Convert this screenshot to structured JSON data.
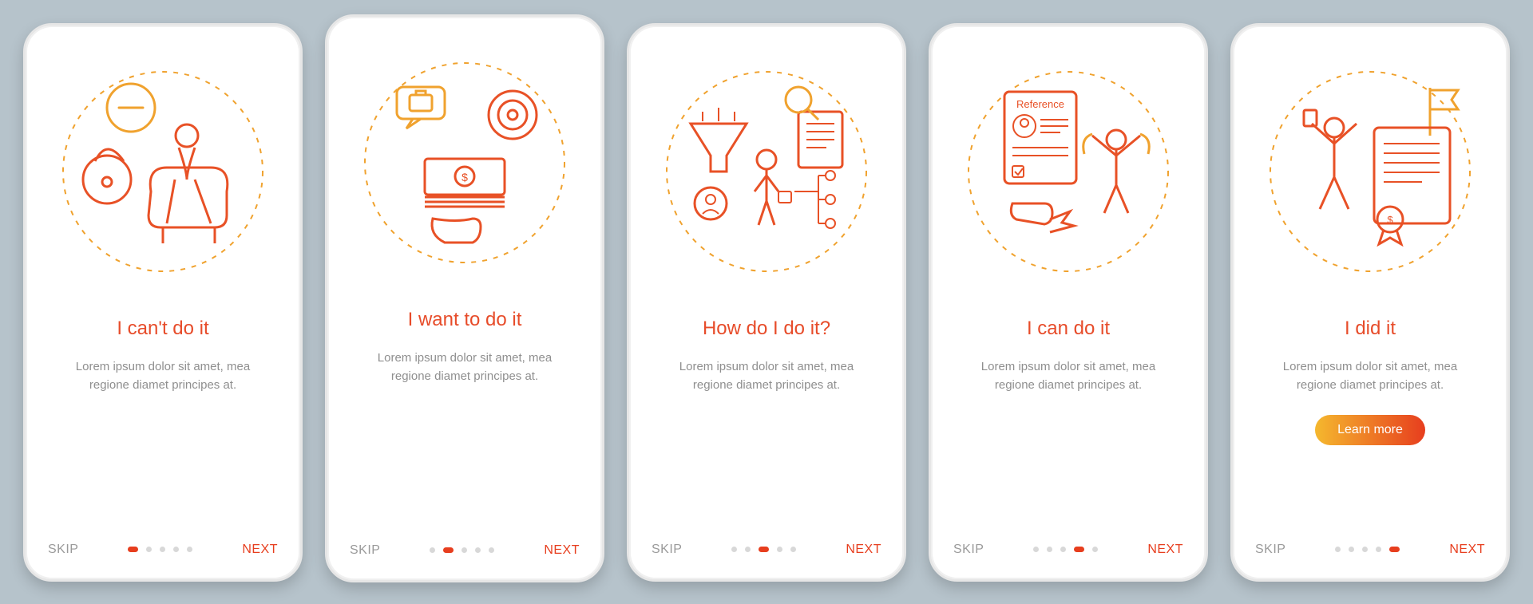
{
  "screens": [
    {
      "title": "I can't do it",
      "desc": "Lorem ipsum dolor sit amet, mea regione diamet principes at.",
      "skip": "SKIP",
      "next": "NEXT",
      "cta": null,
      "activeDot": 0
    },
    {
      "title": "I want to do it",
      "desc": "Lorem ipsum dolor sit amet, mea regione diamet principes at.",
      "skip": "SKIP",
      "next": "NEXT",
      "cta": null,
      "activeDot": 1
    },
    {
      "title": "How do I do it?",
      "desc": "Lorem ipsum dolor sit amet, mea regione diamet principes at.",
      "skip": "SKIP",
      "next": "NEXT",
      "cta": null,
      "activeDot": 2
    },
    {
      "title": "I can do it",
      "desc": "Lorem ipsum dolor sit amet, mea regione diamet principes at.",
      "skip": "SKIP",
      "next": "NEXT",
      "cta": null,
      "activeDot": 3
    },
    {
      "title": "I did it",
      "desc": "Lorem ipsum dolor sit amet, mea regione diamet principes at.",
      "skip": "SKIP",
      "next": "NEXT",
      "cta": "Learn more",
      "activeDot": 4
    }
  ],
  "illustrations": {
    "referenceLabel": "Reference"
  },
  "colors": {
    "accent": "#e73e1e",
    "accentWarm": "#f0a22e",
    "textMuted": "#8f8f8f",
    "background": "#b6c3cb"
  }
}
